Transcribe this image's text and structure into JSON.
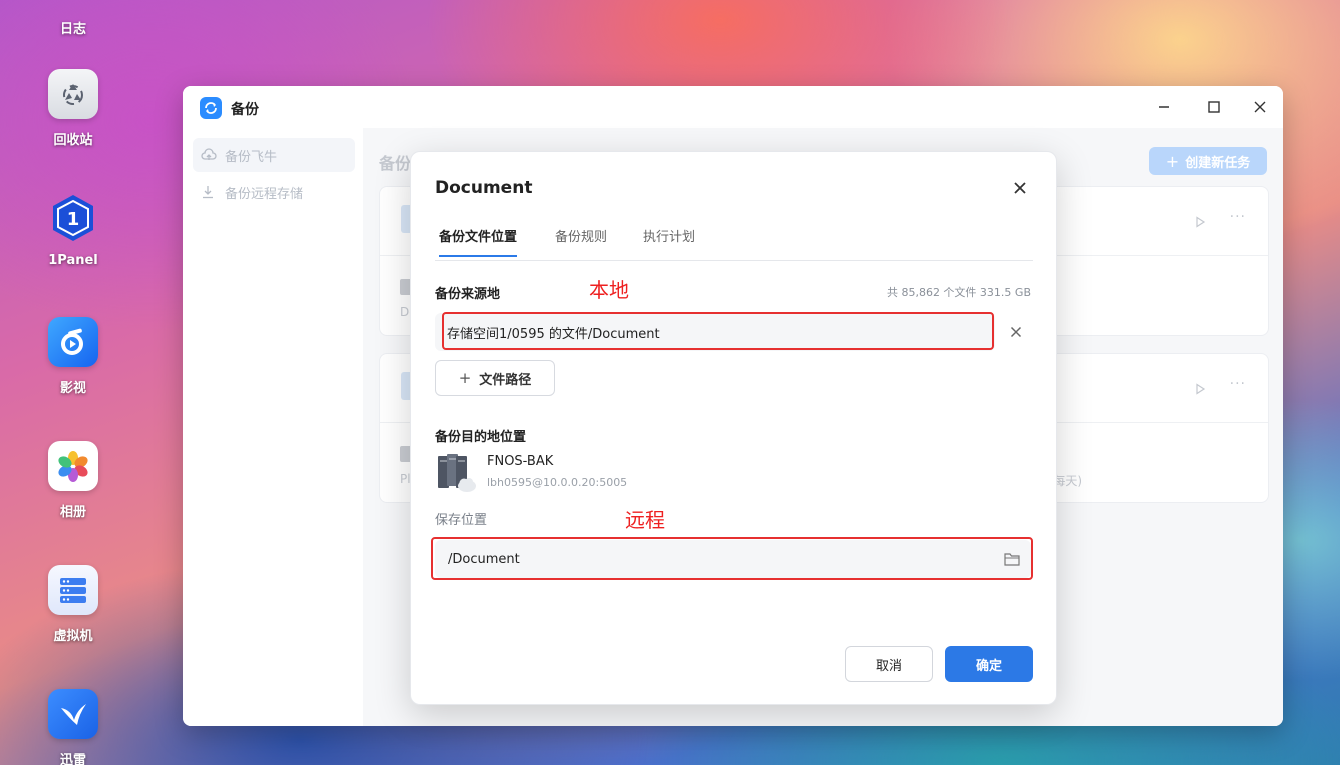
{
  "desktop": {
    "items": [
      {
        "label": "日志",
        "icon": "journal-icon"
      },
      {
        "label": "回收站",
        "icon": "recycle-bin-icon"
      },
      {
        "label": "1Panel",
        "icon": "1panel-icon"
      },
      {
        "label": "影视",
        "icon": "video-icon"
      },
      {
        "label": "相册",
        "icon": "photos-icon"
      },
      {
        "label": "虚拟机",
        "icon": "virtual-machine-icon"
      },
      {
        "label": "迅雷",
        "icon": "xunlei-icon"
      }
    ]
  },
  "window": {
    "title": "备份",
    "controls": [
      "minimize",
      "maximize",
      "close"
    ]
  },
  "sidebar": {
    "items": [
      {
        "label": "备份飞牛",
        "icon": "cloud-upload-icon"
      },
      {
        "label": "备份远程存储",
        "icon": "download-icon"
      }
    ]
  },
  "main": {
    "title": "备份",
    "create_button": "创建新任务",
    "cards": [
      {
        "row_text": "Do",
        "row_tail": ""
      },
      {
        "row_text": "Pl",
        "row_tail": "每天)"
      }
    ]
  },
  "dialog": {
    "title": "Document",
    "tabs": [
      {
        "label": "备份文件位置",
        "active": true
      },
      {
        "label": "备份规则",
        "active": false
      },
      {
        "label": "执行计划",
        "active": false
      }
    ],
    "source": {
      "label": "备份来源地",
      "summary": "共 85,862 个文件 331.5 GB",
      "path": "存储空间1/0595 的文件/Document",
      "add_path_button": "文件路径"
    },
    "destination": {
      "label": "备份目的地位置",
      "device_name": "FNOS-BAK",
      "device_address": "lbh0595@10.0.0.20:5005",
      "save_location_label": "保存位置",
      "save_location_value": "/Document"
    },
    "buttons": {
      "cancel": "取消",
      "confirm": "确定"
    }
  },
  "annotations": {
    "local": "本地",
    "remote": "远程",
    "color": "#e63030"
  },
  "colors": {
    "accent": "#2c79e6",
    "annotation": "#e63030"
  }
}
